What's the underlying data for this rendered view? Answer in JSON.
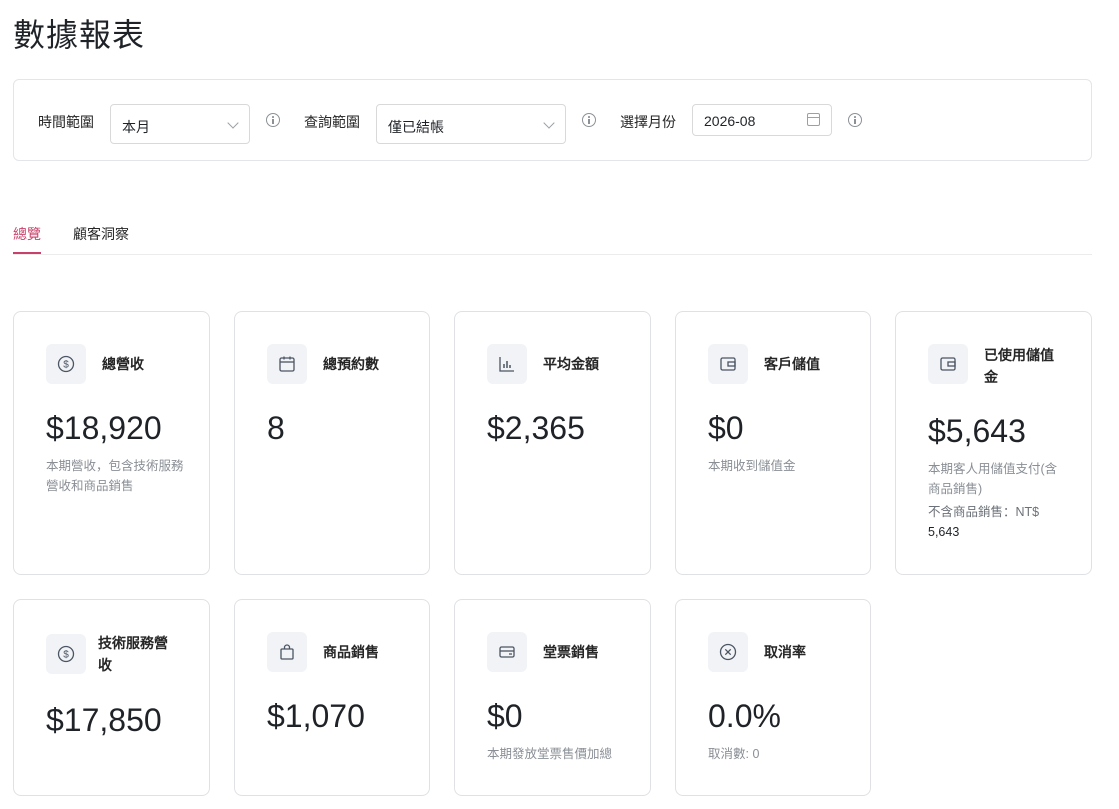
{
  "page": {
    "title": "數據報表"
  },
  "filters": {
    "time_range": {
      "label": "時間範圍",
      "value": "本月"
    },
    "query_range": {
      "label": "查詢範圍",
      "value": "僅已結帳"
    },
    "month": {
      "label": "選擇月份",
      "value": "2026-08"
    }
  },
  "tabs": [
    {
      "label": "總覽",
      "active": true
    },
    {
      "label": "顧客洞察",
      "active": false
    }
  ],
  "accent_color": "#c8416a",
  "cards": [
    {
      "icon": "dollar-circle-icon",
      "title": "總營收",
      "value": "$18,920",
      "desc": "本期營收，包含技術服務營收和商品銷售"
    },
    {
      "icon": "calendar-icon",
      "title": "總預約數",
      "value": "8"
    },
    {
      "icon": "bar-chart-icon",
      "title": "平均金額",
      "value": "$2,365"
    },
    {
      "icon": "wallet-icon",
      "title": "客戶儲值",
      "value": "$0",
      "desc": "本期收到儲值金"
    },
    {
      "icon": "wallet-icon",
      "title": "已使用儲值金",
      "value": "$5,643",
      "desc": "本期客人用儲值支付(含商品銷售)",
      "sub_label": "不含商品銷售：NT$",
      "sub_value": "5,643"
    },
    {
      "icon": "dollar-circle-icon",
      "title": "技術服務營收",
      "value": "$17,850"
    },
    {
      "icon": "shopping-bag-icon",
      "title": "商品銷售",
      "value": "$1,070"
    },
    {
      "icon": "credit-card-icon",
      "title": "堂票銷售",
      "value": "$0",
      "desc": "本期發放堂票售價加總"
    },
    {
      "icon": "close-circle-icon",
      "title": "取消率",
      "value": "0.0%",
      "desc": "取消數: 0"
    }
  ]
}
